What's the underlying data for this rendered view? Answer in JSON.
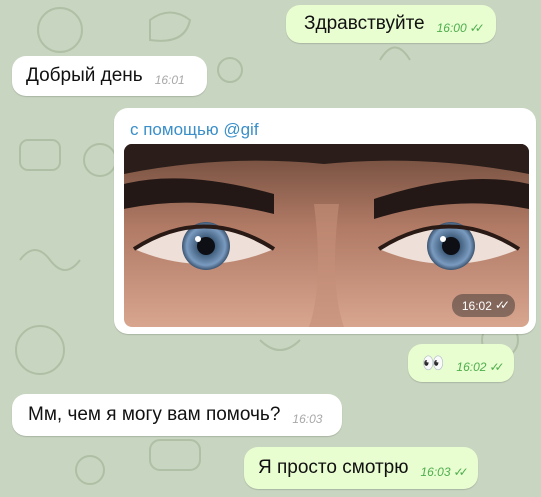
{
  "colors": {
    "wallpaper": "#c8d5c0",
    "outgoing_bubble": "#e8fdd0",
    "incoming_bubble": "#ffffff",
    "outgoing_time": "#4fae4e",
    "via_link": "#3a8fc9"
  },
  "messages": [
    {
      "text": "Здравствуйте",
      "time": "16:00",
      "direction": "outgoing",
      "status": "read-check-icon"
    },
    {
      "text": "Добрый день",
      "time": "16:01",
      "direction": "incoming"
    },
    {
      "via": "с помощью @gif",
      "time": "16:02",
      "direction": "incoming",
      "media": "gif-eyes-closeup",
      "status": "read-check-icon"
    },
    {
      "text": "👀",
      "time": "16:02",
      "direction": "outgoing",
      "status": "read-check-icon"
    },
    {
      "text": "Мм, чем я могу вам помочь?",
      "time": "16:03",
      "direction": "incoming"
    },
    {
      "text": "Я просто смотрю",
      "time": "16:03",
      "direction": "outgoing",
      "status": "read-check-icon"
    }
  ],
  "icons": {
    "read_status": "✓✓"
  }
}
